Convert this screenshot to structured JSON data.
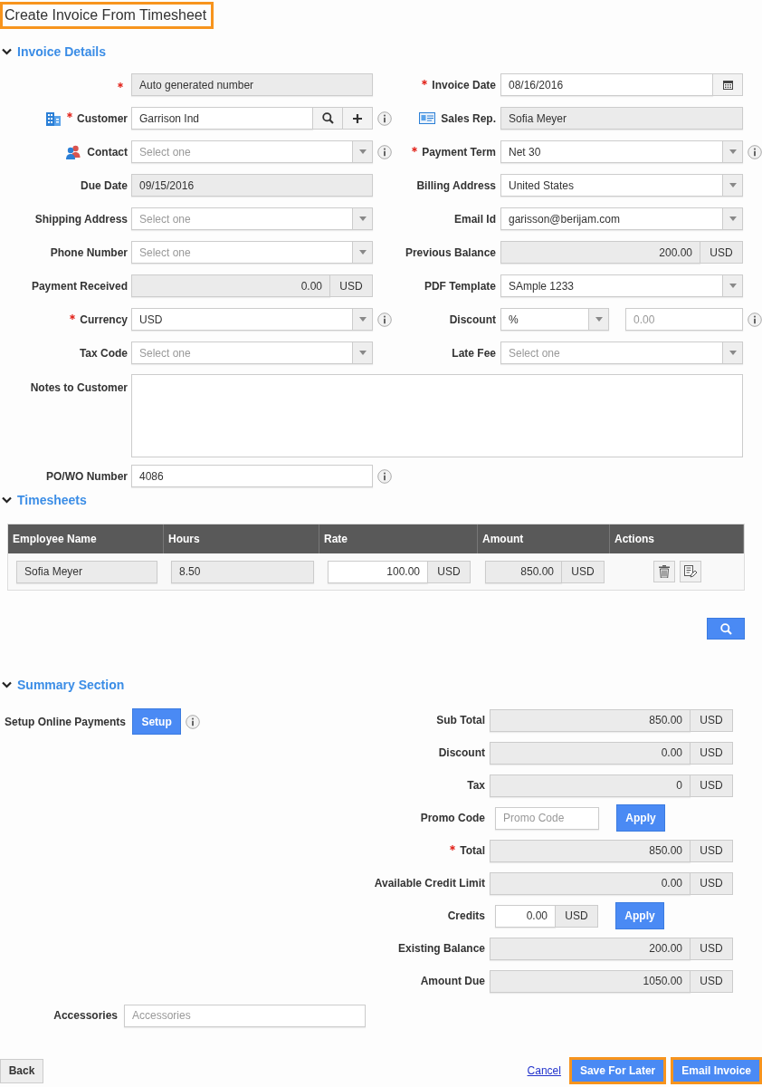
{
  "title": {
    "text": "Create Invoice From Timesheet",
    "highlighted": true
  },
  "invoice_details": {
    "heading": "Invoice Details",
    "expanded": true,
    "rows": [
      {
        "left": {
          "kind": "readonly",
          "required": true,
          "value": "Auto generated number",
          "info": false
        },
        "right": {
          "kind": "date",
          "label": "Invoice Date",
          "required": true,
          "value": "08/16/2016",
          "info": false
        }
      },
      {
        "left": {
          "kind": "lookup",
          "label_icon": true,
          "label": "Customer",
          "required": true,
          "value": "Garrison Ind",
          "info": true
        },
        "right": {
          "kind": "readonly",
          "label_icon": true,
          "label": "Sales Rep.",
          "required": false,
          "value": "Sofia Meyer",
          "info": false
        }
      },
      {
        "left": {
          "kind": "select",
          "label_icon": true,
          "label": "Contact",
          "required": false,
          "placeholder": "Select one",
          "info": true
        },
        "right": {
          "kind": "select",
          "label": "Payment Term",
          "required": true,
          "value": "Net 30",
          "info": true
        }
      },
      {
        "left": {
          "kind": "readonly",
          "label": "Due Date",
          "required": false,
          "value": "09/15/2016",
          "info": false
        },
        "right": {
          "kind": "select",
          "label": "Billing Address",
          "required": false,
          "value": "United States",
          "info": false
        }
      },
      {
        "left": {
          "kind": "select",
          "label": "Shipping Address",
          "required": false,
          "placeholder": "Select one",
          "info": false
        },
        "right": {
          "kind": "select",
          "label": "Email Id",
          "required": false,
          "value": "garisson@berijam.com",
          "info": false
        }
      },
      {
        "left": {
          "kind": "select",
          "label": "Phone Number",
          "required": false,
          "placeholder": "Select one",
          "info": false
        },
        "right": {
          "kind": "amount",
          "label": "Previous Balance",
          "required": false,
          "value": "200.00",
          "currency": "USD",
          "info": false
        }
      },
      {
        "left": {
          "kind": "amount",
          "label": "Payment Received",
          "required": false,
          "value": "0.00",
          "currency": "USD",
          "info": false
        },
        "right": {
          "kind": "select",
          "label": "PDF Template",
          "required": false,
          "value": "SAmple 1233",
          "info": false
        }
      },
      {
        "left": {
          "kind": "select",
          "label": "Currency",
          "required": true,
          "value": "USD",
          "info": true
        },
        "right": {
          "kind": "discount",
          "label": "Discount",
          "required": false,
          "value": "%",
          "placeholder": "0.00",
          "info": true
        }
      },
      {
        "left": {
          "kind": "select",
          "label": "Tax Code",
          "required": false,
          "placeholder": "Select one",
          "info": false
        },
        "right": {
          "kind": "select",
          "label": "Late Fee",
          "required": false,
          "placeholder": "Select one",
          "info": false
        }
      }
    ],
    "notes": {
      "label": "Notes to Customer"
    },
    "po_number": {
      "label": "PO/WO Number",
      "value": "4086",
      "info": true
    }
  },
  "timesheets": {
    "heading": "Timesheets",
    "expanded": true,
    "columns": [
      "Employee Name",
      "Hours",
      "Rate",
      "Amount",
      "Actions"
    ],
    "rows": [
      {
        "employee_name": "Sofia Meyer",
        "hours": "8.50",
        "rate": "100.00",
        "rate_currency": "USD",
        "amount": "850.00",
        "amount_currency": "USD"
      }
    ]
  },
  "summary": {
    "heading": "Summary Section",
    "expanded": true,
    "online_payments": {
      "label": "Setup Online Payments",
      "button": "Setup",
      "info": true
    },
    "rows": [
      {
        "kind": "amount",
        "label": "Sub Total",
        "required": false,
        "value": "850.00",
        "currency": "USD"
      },
      {
        "kind": "amount",
        "label": "Discount",
        "required": false,
        "value": "0.00",
        "currency": "USD"
      },
      {
        "kind": "amount",
        "label": "Tax",
        "required": false,
        "value": "0",
        "currency": "USD"
      },
      {
        "kind": "promo",
        "label": "Promo Code",
        "required": false,
        "placeholder": "Promo Code",
        "button": "Apply"
      },
      {
        "kind": "amount",
        "label": "Total",
        "required": true,
        "value": "850.00",
        "currency": "USD"
      },
      {
        "kind": "amount",
        "label": "Available Credit Limit",
        "required": false,
        "value": "0.00",
        "currency": "USD"
      },
      {
        "kind": "credits",
        "label": "Credits",
        "required": false,
        "value": "0.00",
        "currency": "USD",
        "button": "Apply"
      },
      {
        "kind": "amount",
        "label": "Existing Balance",
        "required": false,
        "value": "200.00",
        "currency": "USD"
      },
      {
        "kind": "amount",
        "label": "Amount Due",
        "required": false,
        "value": "1050.00",
        "currency": "USD"
      }
    ]
  },
  "accessories": {
    "label": "Accessories",
    "placeholder": "Accessories"
  },
  "footer": [
    {
      "kind": "secondary",
      "label": "Back",
      "highlighted": false
    },
    {
      "kind": "link",
      "label": "Cancel",
      "highlighted": false
    },
    {
      "kind": "primary",
      "label": "Save For Later",
      "highlighted": true
    },
    {
      "kind": "primary",
      "label": "Email Invoice",
      "highlighted": true
    }
  ]
}
